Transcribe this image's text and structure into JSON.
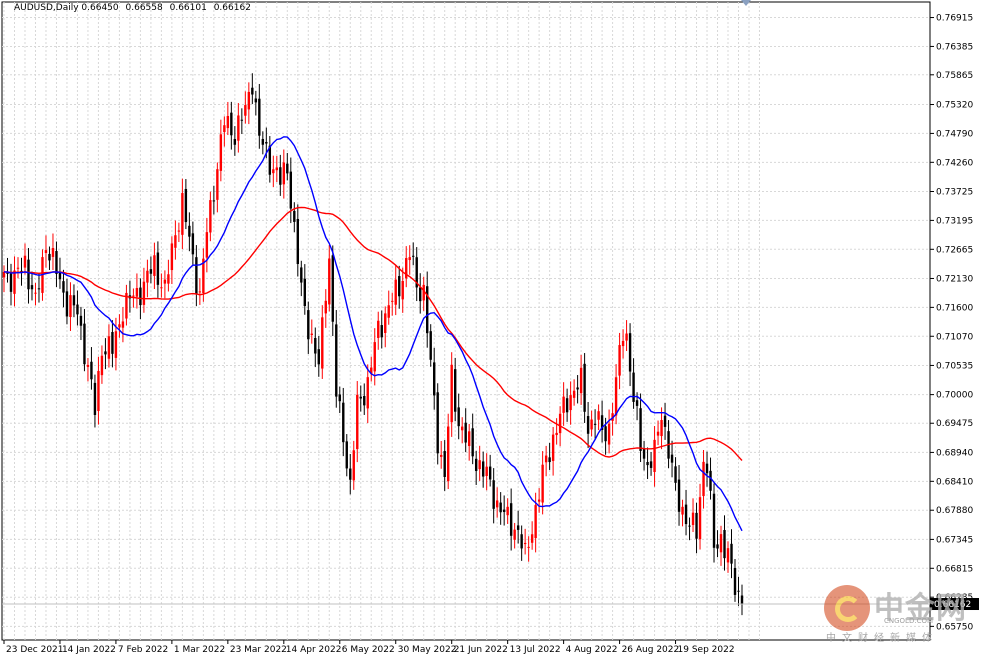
{
  "header": {
    "symbol": "AUDUSD,Daily",
    "open": "0.66450",
    "high": "0.66558",
    "low": "0.66101",
    "close": "0.66162"
  },
  "watermark": {
    "name": "中金网",
    "url": "CNGOLD.COM",
    "subtitle": "中文财经新媒体"
  },
  "current_price_label": "0.66162",
  "colors": {
    "bull": "#ff0000",
    "bear": "#000000",
    "ma_fast": "#0000ff",
    "ma_slow": "#ff0000",
    "grid": "#d8d8d8"
  },
  "chart_data": {
    "type": "candlestick",
    "ylim": [
      0.655,
      0.772
    ],
    "y_ticks": [
      "0.76915",
      "0.76385",
      "0.75865",
      "0.75320",
      "0.74790",
      "0.74260",
      "0.73725",
      "0.73195",
      "0.72665",
      "0.72130",
      "0.71600",
      "0.71070",
      "0.70535",
      "0.70000",
      "0.69475",
      "0.68940",
      "0.68410",
      "0.67880",
      "0.67345",
      "0.66815",
      "0.66285",
      "0.65750"
    ],
    "x_labels": [
      "23 Dec 2021",
      "14 Jan 2022",
      "7 Feb 2022",
      "1 Mar 2022",
      "23 Mar 2022",
      "14 Apr 2022",
      "6 May 2022",
      "30 May 2022",
      "21 Jun 2022",
      "13 Jul 2022",
      "4 Aug 2022",
      "26 Aug 2022",
      "19 Sep 2022"
    ],
    "anchors": [
      [
        0,
        0.7225
      ],
      [
        3,
        0.721
      ],
      [
        6,
        0.7245
      ],
      [
        9,
        0.7165
      ],
      [
        12,
        0.728
      ],
      [
        15,
        0.7225
      ],
      [
        18,
        0.717
      ],
      [
        21,
        0.715
      ],
      [
        24,
        0.705
      ],
      [
        26,
        0.697
      ],
      [
        28,
        0.709
      ],
      [
        31,
        0.708
      ],
      [
        34,
        0.716
      ],
      [
        37,
        0.718
      ],
      [
        40,
        0.72
      ],
      [
        43,
        0.724
      ],
      [
        46,
        0.719
      ],
      [
        49,
        0.73
      ],
      [
        51,
        0.735
      ],
      [
        54,
        0.725
      ],
      [
        56,
        0.718
      ],
      [
        58,
        0.73
      ],
      [
        61,
        0.742
      ],
      [
        63,
        0.75
      ],
      [
        66,
        0.748
      ],
      [
        69,
        0.752
      ],
      [
        71,
        0.758
      ],
      [
        73,
        0.747
      ],
      [
        76,
        0.743
      ],
      [
        79,
        0.739
      ],
      [
        81,
        0.742
      ],
      [
        83,
        0.73
      ],
      [
        85,
        0.719
      ],
      [
        88,
        0.71
      ],
      [
        90,
        0.705
      ],
      [
        92,
        0.72
      ],
      [
        93,
        0.725
      ],
      [
        95,
        0.7
      ],
      [
        97,
        0.693
      ],
      [
        99,
        0.683
      ],
      [
        101,
        0.698
      ],
      [
        104,
        0.702
      ],
      [
        107,
        0.712
      ],
      [
        110,
        0.716
      ],
      [
        113,
        0.72
      ],
      [
        116,
        0.726
      ],
      [
        118,
        0.72
      ],
      [
        120,
        0.719
      ],
      [
        122,
        0.705
      ],
      [
        124,
        0.692
      ],
      [
        126,
        0.685
      ],
      [
        128,
        0.703
      ],
      [
        130,
        0.695
      ],
      [
        132,
        0.692
      ],
      [
        135,
        0.688
      ],
      [
        138,
        0.685
      ],
      [
        141,
        0.68
      ],
      [
        144,
        0.677
      ],
      [
        147,
        0.675
      ],
      [
        149,
        0.67
      ],
      [
        151,
        0.676
      ],
      [
        153,
        0.682
      ],
      [
        155,
        0.688
      ],
      [
        158,
        0.694
      ],
      [
        161,
        0.699
      ],
      [
        163,
        0.701
      ],
      [
        165,
        0.702
      ],
      [
        167,
        0.694
      ],
      [
        169,
        0.696
      ],
      [
        171,
        0.693
      ],
      [
        173,
        0.694
      ],
      [
        175,
        0.702
      ],
      [
        177,
        0.712
      ],
      [
        178,
        0.711
      ],
      [
        180,
        0.699
      ],
      [
        182,
        0.691
      ],
      [
        184,
        0.687
      ],
      [
        186,
        0.689
      ],
      [
        188,
        0.697
      ],
      [
        190,
        0.69
      ],
      [
        192,
        0.682
      ],
      [
        194,
        0.679
      ],
      [
        196,
        0.676
      ],
      [
        198,
        0.675
      ],
      [
        200,
        0.688
      ],
      [
        201,
        0.687
      ],
      [
        203,
        0.672
      ],
      [
        205,
        0.674
      ],
      [
        207,
        0.67
      ],
      [
        209,
        0.665
      ],
      [
        211,
        0.6616
      ]
    ],
    "bars": 212,
    "ma_fast_period": 20,
    "ma_slow_period": 50
  }
}
